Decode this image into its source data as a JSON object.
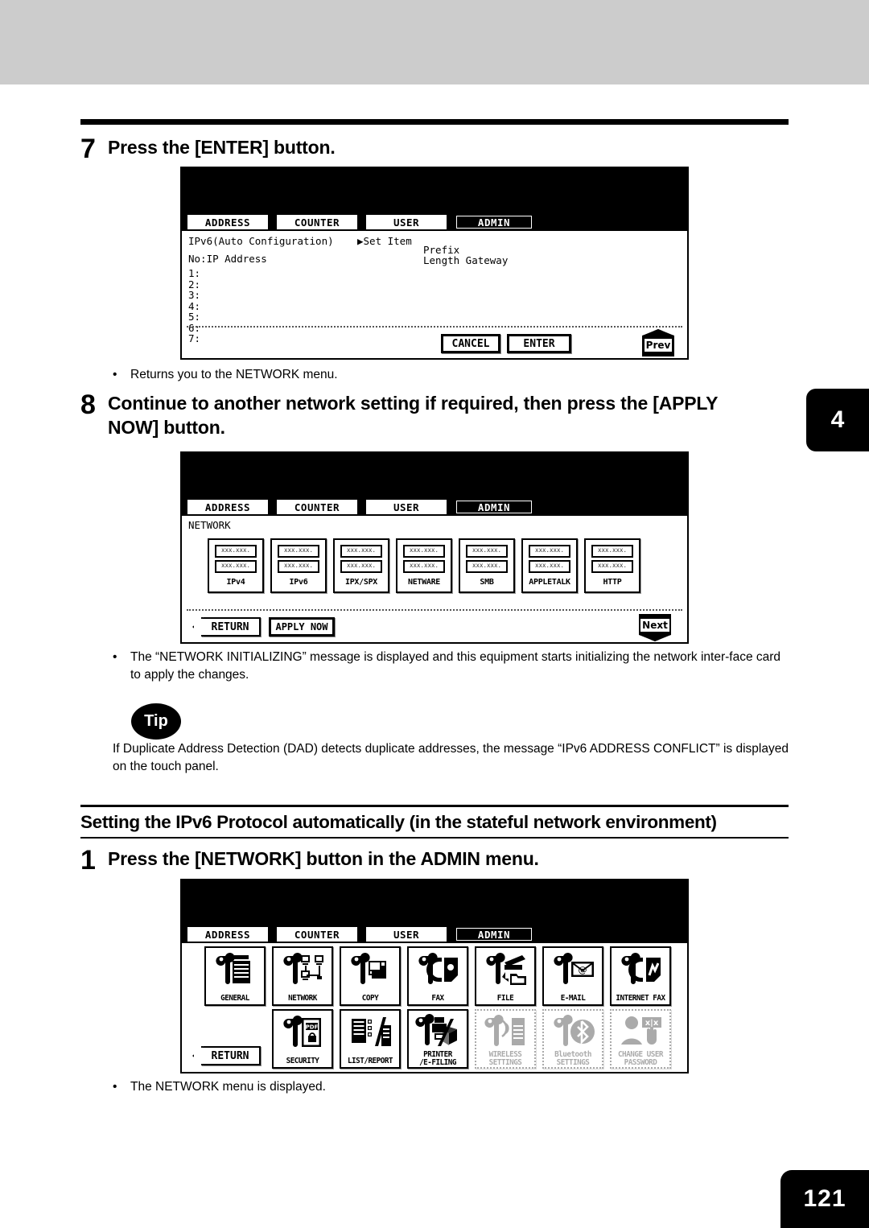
{
  "page": {
    "number": "121",
    "chapter_tab": "4"
  },
  "steps": [
    {
      "num": "7",
      "text": "Press the [ENTER] button.",
      "note": "Returns you to the NETWORK menu."
    },
    {
      "num": "8",
      "text": "Continue to another network setting if required, then press the [APPLY NOW] button.",
      "note": "The “NETWORK INITIALIZING” message is displayed and this equipment starts initializing the network inter-face card to apply the changes."
    },
    {
      "num": "1",
      "text": "Press the [NETWORK] button in the ADMIN menu.",
      "note": "The NETWORK menu is displayed."
    }
  ],
  "tip": {
    "badge": "Tip",
    "text": "If Duplicate Address Detection (DAD) detects duplicate addresses, the message “IPv6 ADDRESS CONFLICT” is displayed on the touch panel."
  },
  "section": {
    "heading": "Setting the IPv6 Protocol automatically (in the stateful network environment)"
  },
  "tabs": [
    {
      "label": "ADDRESS",
      "active": false
    },
    {
      "label": "COUNTER",
      "active": false
    },
    {
      "label": "USER",
      "active": false
    },
    {
      "label": "ADMIN",
      "active": true
    }
  ],
  "panel_ipv6": {
    "title": "IPv6(Auto Configuration)",
    "set_item": "Set Item",
    "col_prefix": "Prefix",
    "col_length_gateway": "Length  Gateway",
    "col_no_ip": "No:IP Address",
    "rows": [
      "1:",
      "2:",
      "3:",
      "4:",
      "5:",
      "6:",
      "7:"
    ],
    "buttons": {
      "cancel": "CANCEL",
      "enter": "ENTER",
      "prev": "Prev"
    }
  },
  "panel_network": {
    "title": "NETWORK",
    "tile_value_line1": "xxx.xxx.",
    "tile_value_line2": "xxx.xxx.",
    "tiles": [
      "IPv4",
      "IPv6",
      "IPX/SPX",
      "NETWARE",
      "SMB",
      "APPLETALK",
      "HTTP"
    ],
    "buttons": {
      "return": "RETURN",
      "apply_now": "APPLY NOW",
      "next": "Next"
    }
  },
  "panel_admin": {
    "row1": [
      {
        "label": "GENERAL",
        "icon": "wrench-printer-icon",
        "disabled": false
      },
      {
        "label": "NETWORK",
        "icon": "wrench-network-icon",
        "disabled": false
      },
      {
        "label": "COPY",
        "icon": "wrench-copy-icon",
        "disabled": false
      },
      {
        "label": "FAX",
        "icon": "wrench-fax-icon",
        "disabled": false
      },
      {
        "label": "FILE",
        "icon": "wrench-file-icon",
        "disabled": false
      },
      {
        "label": "E-MAIL",
        "icon": "wrench-email-icon",
        "disabled": false
      },
      {
        "label": "INTERNET FAX",
        "icon": "wrench-internetfax-icon",
        "disabled": false
      }
    ],
    "row2": [
      {
        "label": "SECURITY",
        "icon": "wrench-pdf-lock-icon",
        "disabled": false
      },
      {
        "label": "LIST/REPORT",
        "icon": "list-report-icon",
        "disabled": false
      },
      {
        "label": "PRINTER\n/E-FILING",
        "icon": "wrench-printer-box-icon",
        "disabled": false
      },
      {
        "label": "WIRELESS\nSETTINGS",
        "icon": "wrench-wireless-icon",
        "disabled": true
      },
      {
        "label": "Bluetooth\nSETTINGS",
        "icon": "wrench-bluetooth-icon",
        "disabled": true
      },
      {
        "label": "CHANGE USER\nPASSWORD",
        "icon": "user-password-icon",
        "disabled": true
      }
    ],
    "buttons": {
      "return": "RETURN"
    }
  }
}
